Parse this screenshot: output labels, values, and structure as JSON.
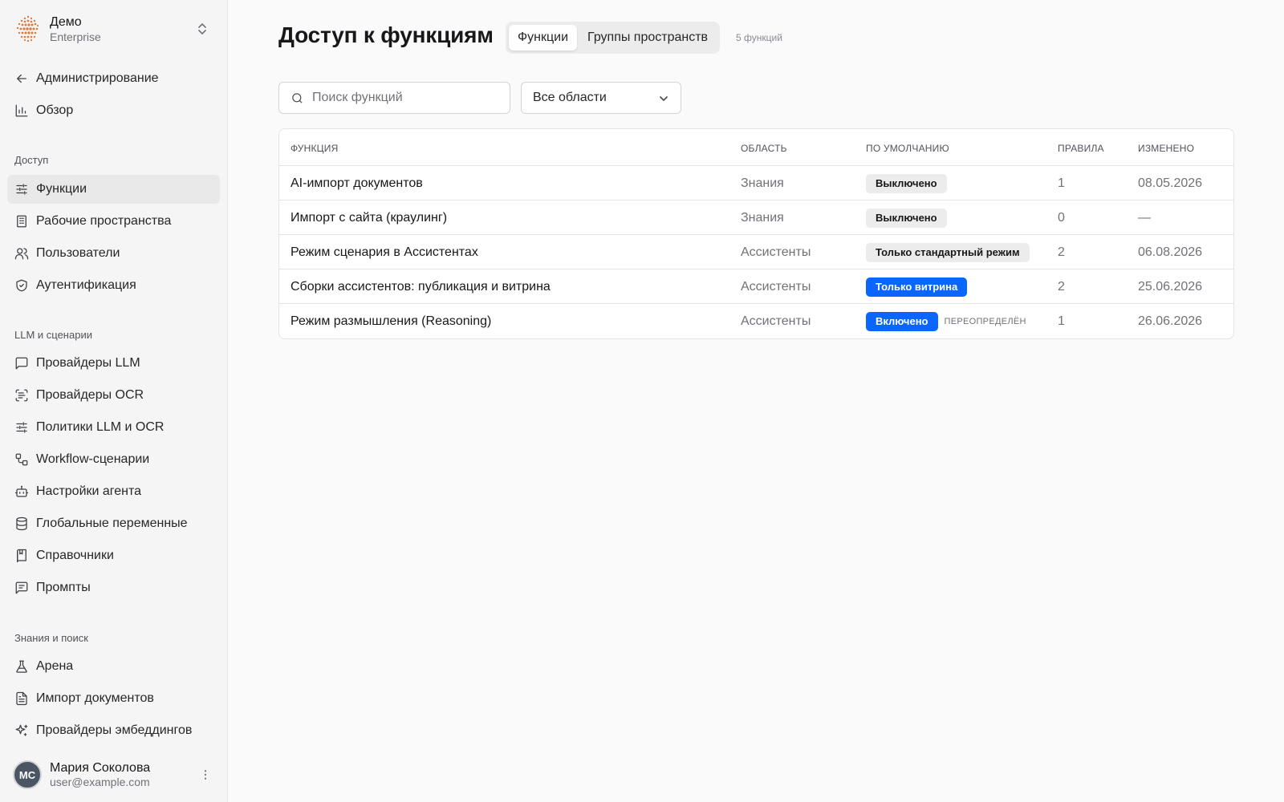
{
  "org": {
    "name": "Демо",
    "plan": "Enterprise"
  },
  "nav_top": [
    {
      "label": "Администрирование",
      "icon": "arrow-left-icon"
    },
    {
      "label": "Обзор",
      "icon": "bar-chart-icon"
    }
  ],
  "sections": {
    "access": "Доступ",
    "llm": "LLM и сценарии",
    "knowledge": "Знания и поиск"
  },
  "nav_access": [
    {
      "label": "Функции",
      "icon": "sliders-icon",
      "active": true
    },
    {
      "label": "Рабочие пространства",
      "icon": "building-icon"
    },
    {
      "label": "Пользователи",
      "icon": "users-icon"
    },
    {
      "label": "Аутентификация",
      "icon": "shield-check-icon"
    }
  ],
  "nav_llm": [
    {
      "label": "Провайдеры LLM",
      "icon": "message-square-icon"
    },
    {
      "label": "Провайдеры OCR",
      "icon": "scan-text-icon"
    },
    {
      "label": "Политики LLM и OCR",
      "icon": "sliders-icon"
    },
    {
      "label": "Workflow-сценарии",
      "icon": "workflow-icon"
    },
    {
      "label": "Настройки агента",
      "icon": "bot-icon"
    },
    {
      "label": "Глобальные переменные",
      "icon": "database-icon"
    },
    {
      "label": "Справочники",
      "icon": "book-icon"
    },
    {
      "label": "Промпты",
      "icon": "message-text-icon"
    }
  ],
  "nav_knowledge": [
    {
      "label": "Арена",
      "icon": "flask-icon"
    },
    {
      "label": "Импорт документов",
      "icon": "file-text-icon"
    },
    {
      "label": "Провайдеры эмбеддингов",
      "icon": "sparkles-icon"
    }
  ],
  "user": {
    "initials": "МС",
    "name": "Мария Соколова",
    "email": "user@example.com"
  },
  "main": {
    "title": "Доступ к функциям",
    "tabs": [
      {
        "label": "Функции",
        "active": true
      },
      {
        "label": "Группы пространств",
        "active": false
      }
    ],
    "count": "5 функций",
    "search": {
      "placeholder": "Поиск функций",
      "value": ""
    },
    "filter": {
      "selected": "Все области"
    },
    "columns": [
      "ФУНКЦИЯ",
      "ОБЛАСТЬ",
      "ПО УМОЛЧАНИЮ",
      "ПРАВИЛА",
      "ИЗМЕНЕНО"
    ],
    "rows": [
      {
        "name": "AI-импорт документов",
        "area": "Знания",
        "default": "Выключено",
        "default_style": "off",
        "override": "",
        "rules": "1",
        "changed": "08.05.2026"
      },
      {
        "name": "Импорт с сайта (краулинг)",
        "area": "Знания",
        "default": "Выключено",
        "default_style": "off",
        "override": "",
        "rules": "0",
        "changed": "—"
      },
      {
        "name": "Режим сценария в Ассистентах",
        "area": "Ассистенты",
        "default": "Только стандартный режим",
        "default_style": "std",
        "override": "",
        "rules": "2",
        "changed": "06.08.2026"
      },
      {
        "name": "Сборки ассистентов: публикация и витрина",
        "area": "Ассистенты",
        "default": "Только витрина",
        "default_style": "on",
        "override": "",
        "rules": "2",
        "changed": "25.06.2026"
      },
      {
        "name": "Режим размышления (Reasoning)",
        "area": "Ассистенты",
        "default": "Включено",
        "default_style": "on",
        "override": "ПЕРЕОПРЕДЕЛЁН",
        "rules": "1",
        "changed": "26.06.2026"
      }
    ]
  },
  "colors": {
    "accent": "#0a66ff",
    "sidebar_bg": "#f5f5f5",
    "page_bg": "#fafafa"
  }
}
